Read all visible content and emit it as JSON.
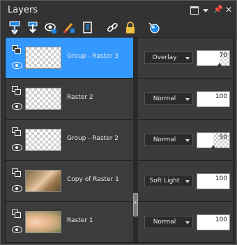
{
  "window": {
    "title": "Layers"
  },
  "toolbar": {
    "tools": [
      "new-raster-layer-icon",
      "new-layer-down-icon",
      "new-mask-layer-icon",
      "paint-layer-icon",
      "layer-properties-icon",
      "link-icon",
      "lock-icon",
      "visibility-toggle-icon"
    ]
  },
  "layers": [
    {
      "name": "Group - Raster 3",
      "blend": "Overlay",
      "opacity": 70,
      "opacity_label": "70",
      "selected": true,
      "thumb": "transparent"
    },
    {
      "name": "Raster 2",
      "blend": "Normal",
      "opacity": 100,
      "opacity_label": "100",
      "selected": false,
      "thumb": "transparent"
    },
    {
      "name": "Group - Raster 2",
      "blend": "Normal",
      "opacity": 50,
      "opacity_label": "50",
      "selected": false,
      "thumb": "transparent"
    },
    {
      "name": "Copy of Raster 1",
      "blend": "Soft Light",
      "opacity": 100,
      "opacity_label": "100",
      "selected": false,
      "thumb": "photo1"
    },
    {
      "name": "Raster 1",
      "blend": "Normal",
      "opacity": 100,
      "opacity_label": "100",
      "selected": false,
      "thumb": "photo2"
    }
  ],
  "colors": {
    "selection": "#3399ff",
    "panel": "#333333"
  }
}
